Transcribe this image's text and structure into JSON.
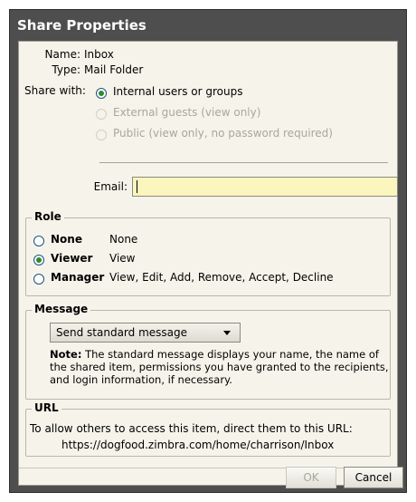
{
  "dialog": {
    "title": "Share Properties"
  },
  "info": {
    "name_label": "Name:",
    "name_value": "Inbox",
    "type_label": "Type:",
    "type_value": "Mail Folder",
    "share_with_label": "Share with:",
    "share_options": [
      {
        "label": "Internal users or groups",
        "selected": true,
        "enabled": true
      },
      {
        "label": "External guests (view only)",
        "selected": false,
        "enabled": false
      },
      {
        "label": "Public (view only, no password required)",
        "selected": false,
        "enabled": false
      }
    ],
    "email_label": "Email:",
    "email_value": ""
  },
  "role": {
    "legend": "Role",
    "options": [
      {
        "name": "None",
        "desc": "None",
        "selected": false
      },
      {
        "name": "Viewer",
        "desc": "View",
        "selected": true
      },
      {
        "name": "Manager",
        "desc": "View, Edit, Add, Remove, Accept, Decline",
        "selected": false
      }
    ]
  },
  "message": {
    "legend": "Message",
    "select_value": "Send standard message",
    "note_bold": "Note:",
    "note_text": " The standard message displays your name, the name of the shared item, permissions you have granted to the recipients, and login information, if necessary."
  },
  "url": {
    "legend": "URL",
    "description": "To allow others to access this item, direct them to this URL:",
    "link": "https://dogfood.zimbra.com/home/charrison/Inbox"
  },
  "buttons": {
    "ok": "OK",
    "cancel": "Cancel"
  },
  "colors": {
    "titlebar": "#4e4e4e",
    "body_bg": "#f6f4ea",
    "email_bg": "#fbf6be",
    "radio_dot": "#2e8a2e"
  }
}
